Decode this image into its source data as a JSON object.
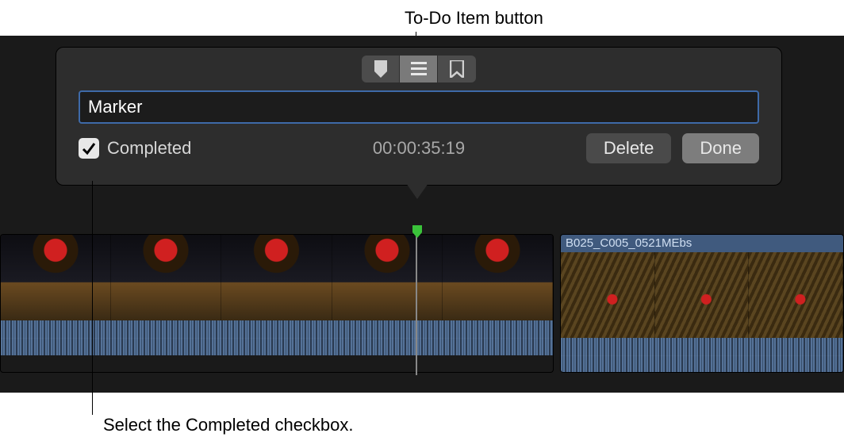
{
  "annotations": {
    "top": "To-Do Item button",
    "bottom": "Select the Completed checkbox."
  },
  "popover": {
    "marker_type_buttons": {
      "standard": "standard-marker",
      "todo": "todo-marker",
      "chapter": "chapter-marker"
    },
    "name_value": "Marker",
    "completed_label": "Completed",
    "completed_checked": true,
    "timecode": "00:00:35:19",
    "delete_label": "Delete",
    "done_label": "Done"
  },
  "timeline": {
    "clip2_label": "B025_C005_0521MEbs"
  }
}
